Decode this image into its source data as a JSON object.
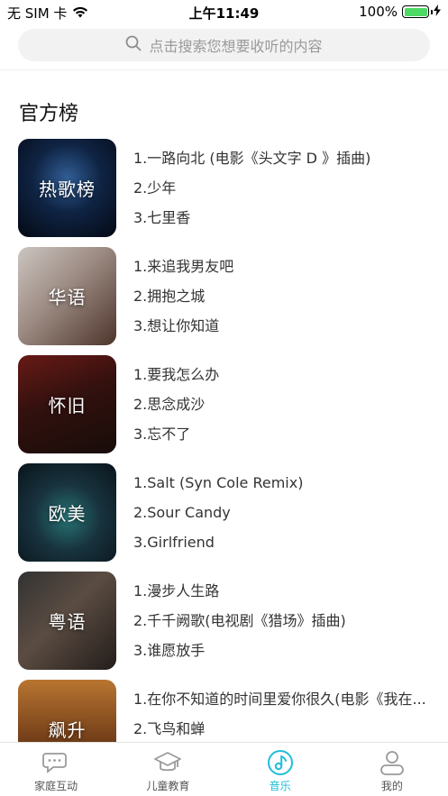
{
  "status_bar": {
    "carrier": "无 SIM 卡",
    "time": "上午11:49",
    "battery": "100%",
    "battery_level": 1.0
  },
  "search": {
    "placeholder": "点击搜索您想要收听的内容"
  },
  "section": {
    "title": "官方榜"
  },
  "ranks": [
    {
      "label": "热歌榜",
      "tracks": [
        "1.一路向北 (电影《头文字 D 》插曲)",
        "2.少年",
        "3.七里香"
      ]
    },
    {
      "label": "华语",
      "tracks": [
        "1.来追我男友吧",
        "2.拥抱之城",
        "3.想让你知道"
      ]
    },
    {
      "label": "怀旧",
      "tracks": [
        "1.要我怎么办",
        "2.思念成沙",
        "3.忘不了"
      ]
    },
    {
      "label": "欧美",
      "tracks": [
        "1.Salt (Syn Cole Remix)",
        "2.Sour Candy",
        "3.Girlfriend"
      ]
    },
    {
      "label": "粤语",
      "tracks": [
        "1.漫步人生路",
        "2.千千阙歌(电视剧《猎场》插曲)",
        "3.谁愿放手"
      ]
    },
    {
      "label": "飙升",
      "tracks": [
        "1.在你不知道的时间里爱你很久(电影《我在...",
        "2.飞鸟和蝉",
        ""
      ]
    }
  ],
  "tabs": [
    {
      "label": "家庭互动",
      "icon": "chat-bubble-icon",
      "active": false
    },
    {
      "label": "儿童教育",
      "icon": "graduation-cap-icon",
      "active": false
    },
    {
      "label": "音乐",
      "icon": "music-note-icon",
      "active": true
    },
    {
      "label": "我的",
      "icon": "user-icon",
      "active": false
    }
  ],
  "colors": {
    "accent": "#1fbfd9",
    "battery_green": "#4cd964",
    "search_bg": "#f2f2f2"
  }
}
